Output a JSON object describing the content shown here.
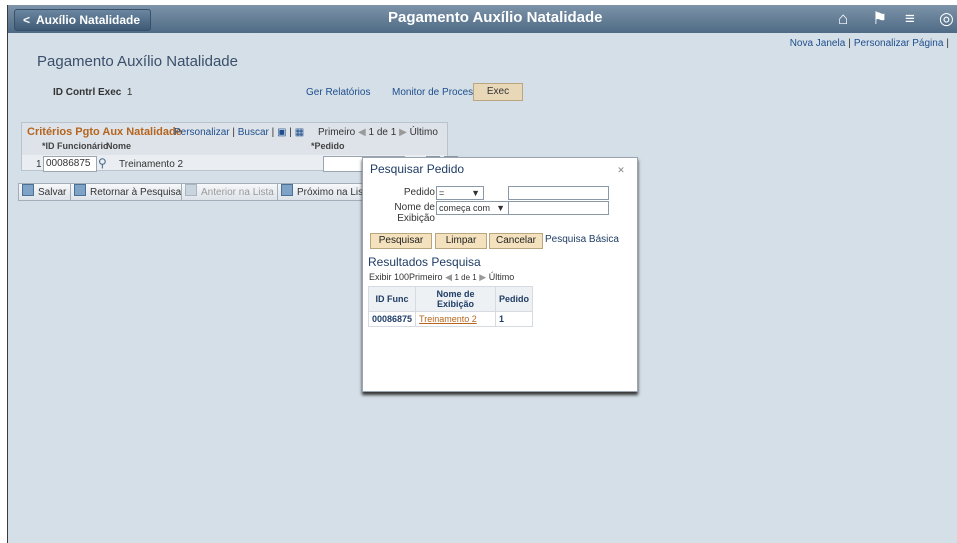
{
  "topbar": {
    "back_label": "Auxílio Natalidade",
    "title": "Pagamento Auxílio Natalidade",
    "icons": [
      "home-icon",
      "flag-icon",
      "menu-icon",
      "compass-icon"
    ]
  },
  "top_links": {
    "new_window": "Nova Janela",
    "personalize": "Personalizar Página"
  },
  "page": {
    "title": "Pagamento Auxílio Natalidade",
    "run_control_label": "ID Contrl Exec",
    "run_control_value": "1",
    "report_manager": "Ger Relatórios",
    "process_monitor": "Monitor de Processos",
    "exec_button": "Exec"
  },
  "grid": {
    "title": "Critérios Pgto Aux Natalidade",
    "personalize": "Personalizar",
    "find": "Buscar",
    "first": "Primeiro",
    "range": "1 de 1",
    "last": "Último",
    "col_id": "*ID Funcionário",
    "col_nome": "Nome",
    "col_pedido": "*Pedido",
    "row_num": "1",
    "row_id": "00086875",
    "row_nome": "Treinamento 2",
    "add": "+",
    "remove": "−"
  },
  "toolbar": {
    "save": "Salvar",
    "return": "Retornar à Pesquisa",
    "previous": "Anterior na Lista",
    "next": "Próximo na Lista"
  },
  "modal": {
    "title": "Pesquisar Pedido",
    "pedido_label": "Pedido",
    "pedido_op": "=",
    "nome_label": "Nome de Exibição",
    "nome_op": "começa com",
    "search_button": "Pesquisar",
    "clear_button": "Limpar",
    "cancel_button": "Cancelar",
    "basic_search": "Pesquisa Básica",
    "results_title": "Resultados Pesquisa",
    "show": "Exibir 100",
    "first": "Primeiro",
    "range": "1 de 1",
    "last": "Último",
    "headers": [
      "ID Func",
      "Nome de Exibição",
      "Pedido"
    ],
    "rows": [
      [
        "00086875",
        "Treinamento 2",
        "1"
      ]
    ]
  }
}
